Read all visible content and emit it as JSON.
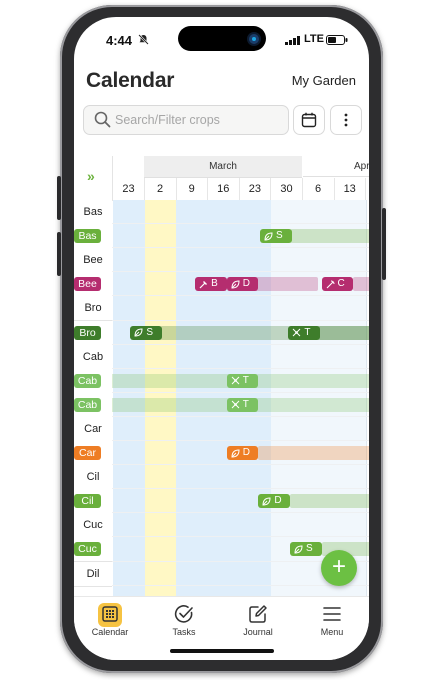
{
  "status_bar": {
    "time": "4:44",
    "network": "LTE"
  },
  "header": {
    "title": "Calendar",
    "garden": "My Garden"
  },
  "search": {
    "placeholder": "Search/Filter crops"
  },
  "timeline": {
    "expand_glyph": "»",
    "months": [
      {
        "label": "March"
      },
      {
        "label": "Apr"
      }
    ],
    "weeks": [
      "23",
      "2",
      "9",
      "16",
      "23",
      "30",
      "6",
      "13"
    ]
  },
  "crops": [
    {
      "label": "Bas",
      "pill": false
    },
    {
      "label": "Bas",
      "pill": true,
      "color": "#6ab03c"
    },
    {
      "label": "Bee",
      "pill": false
    },
    {
      "label": "Bee",
      "pill": true,
      "color": "#b52d6f"
    },
    {
      "label": "Bro",
      "pill": false
    },
    {
      "label": "Bro",
      "pill": true,
      "color": "#3e7d2b"
    },
    {
      "label": "Cab",
      "pill": false
    },
    {
      "label": "Cab",
      "pill": true,
      "color": "#7cc263"
    },
    {
      "label": "Cab",
      "pill": true,
      "color": "#7cc263"
    },
    {
      "label": "Car",
      "pill": false
    },
    {
      "label": "Car",
      "pill": true,
      "color": "#ee7d24"
    },
    {
      "label": "Cil",
      "pill": false
    },
    {
      "label": "Cil",
      "pill": true,
      "color": "#6ab03c"
    },
    {
      "label": "Cuc",
      "pill": false
    },
    {
      "label": "Cuc",
      "pill": true,
      "color": "#6ab03c"
    },
    {
      "label": "Dil",
      "pill": false
    }
  ],
  "events": [
    {
      "row": 1,
      "icon": "leaf-icon",
      "letter": "S",
      "color": "#6ab03c"
    },
    {
      "row": 3,
      "icon": "shovel-icon",
      "letter": "B",
      "color": "#b52d6f"
    },
    {
      "row": 3,
      "icon": "leaf-icon",
      "letter": "D",
      "color": "#b52d6f"
    },
    {
      "row": 3,
      "icon": "harvest-icon",
      "letter": "C",
      "color": "#b52d6f"
    },
    {
      "row": 5,
      "icon": "leaf-icon",
      "letter": "S",
      "color": "#3e7d2b"
    },
    {
      "row": 5,
      "icon": "transplant-icon",
      "letter": "T",
      "color": "#3e7d2b"
    },
    {
      "row": 7,
      "icon": "transplant-icon",
      "letter": "T",
      "color": "#7cc263"
    },
    {
      "row": 8,
      "icon": "transplant-icon",
      "letter": "T",
      "color": "#7cc263"
    },
    {
      "row": 10,
      "icon": "leaf-icon",
      "letter": "D",
      "color": "#ee7d24"
    },
    {
      "row": 12,
      "icon": "leaf-icon",
      "letter": "D",
      "color": "#6ab03c"
    },
    {
      "row": 14,
      "icon": "leaf-icon",
      "letter": "S",
      "color": "#6ab03c"
    }
  ],
  "fab": {
    "label": "+"
  },
  "nav": [
    {
      "label": "Calendar",
      "icon": "calendar-icon",
      "active": true
    },
    {
      "label": "Tasks",
      "icon": "check-circle-icon",
      "active": false
    },
    {
      "label": "Journal",
      "icon": "edit-icon",
      "active": false
    },
    {
      "label": "Menu",
      "icon": "hamburger-icon",
      "active": false
    }
  ],
  "colors": {
    "accent": "#6cc043",
    "today_highlight": "#fff8c5",
    "nav_active": "#f6c342"
  }
}
